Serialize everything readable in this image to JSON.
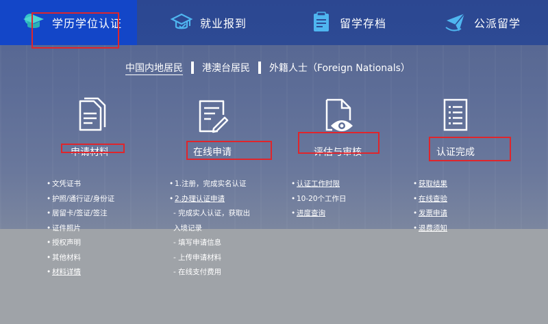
{
  "nav": {
    "tabs": [
      {
        "label": "学历学位认证",
        "icon": "graduate-icon",
        "active": true
      },
      {
        "label": "就业报到",
        "icon": "grad-cap-icon",
        "active": false
      },
      {
        "label": "留学存档",
        "icon": "archive-icon",
        "active": false
      },
      {
        "label": "公派留学",
        "icon": "airplane-globe-icon",
        "active": false
      }
    ]
  },
  "filter": {
    "items": [
      "中国内地居民",
      "港澳台居民",
      "外籍人士（Foreign Nationals）"
    ],
    "selected": "中国内地居民"
  },
  "steps": [
    {
      "label": "申请材料",
      "icon": "documents-icon"
    },
    {
      "label": "在线申请",
      "icon": "form-edit-icon"
    },
    {
      "label": "评估与审核",
      "icon": "document-eye-icon"
    },
    {
      "label": "认证完成",
      "icon": "checklist-icon"
    }
  ],
  "columns": [
    [
      "文凭证书",
      "护照/通行证/身份证",
      "居留卡/签证/签注",
      "证件照片",
      "授权声明",
      "其他材料",
      "材料详情"
    ],
    [
      "1.注册，完成实名认证",
      "2.办理认证申请",
      "- 完成实人认证，获取出",
      "入境记录",
      "- 填写申请信息",
      "- 上传申请材料",
      "- 在线支付费用"
    ],
    [
      "认证工作时限",
      "10-20个工作日",
      "进度查询"
    ],
    [
      "获取结果",
      "在线查验",
      "发票申请",
      "退费须知"
    ]
  ],
  "colors": {
    "nav_bg": "#2d4a94",
    "active_tab": "#1346c8",
    "highlight_box": "#e0252b"
  }
}
